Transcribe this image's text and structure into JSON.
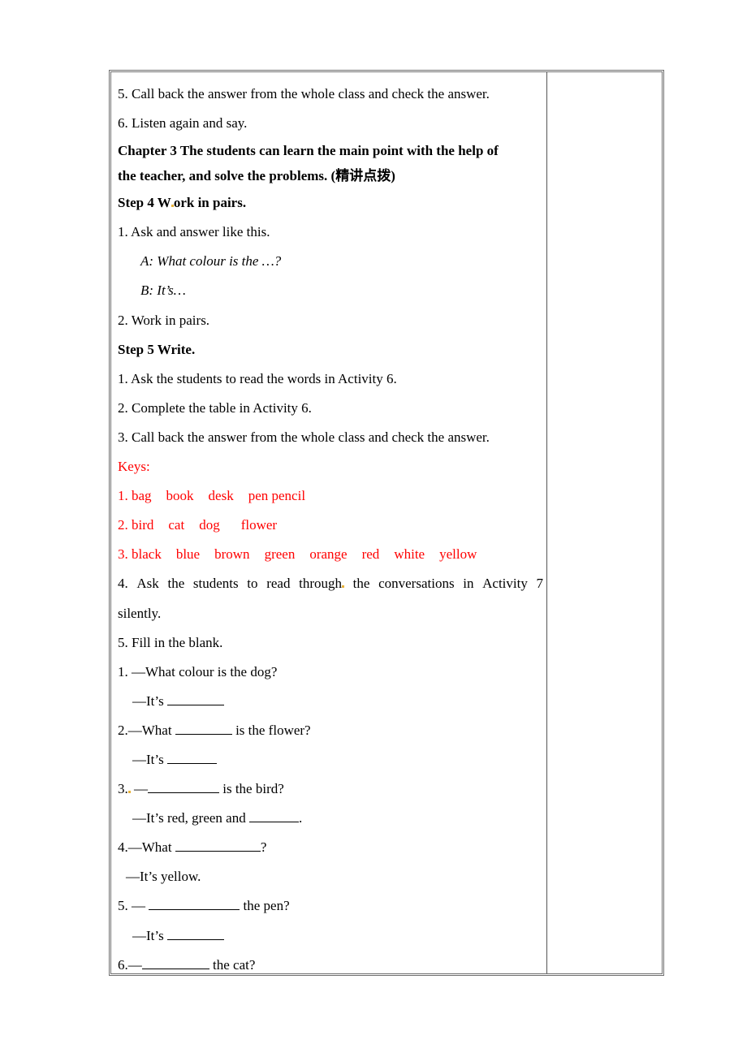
{
  "document": {
    "lines": {
      "l1": "5. Call back the answer from the whole class and check the answer.",
      "l2": "6. Listen again and say.",
      "chapter_a": "Chapter 3 The students can learn the main point with the help of",
      "chapter_b": "the teacher, and solve the problems. (精讲点拨)",
      "step4_a": "Step 4 W",
      "step4_b": "ork in pairs.",
      "s4_1": "1. Ask and answer like this.",
      "s4_a": "A: What colour is the …?",
      "s4_b": "B: It’s…",
      "s4_2": "2. Work in pairs.",
      "step5": "Step 5 Write.",
      "s5_1": "1. Ask the students to read the words in Activity 6.",
      "s5_2": "2. Complete the table in Activity 6.",
      "s5_3": "3. Call back the answer from the whole class and check the answer.",
      "keys": "Keys:",
      "s5_4_words": [
        "4.",
        "Ask",
        "the",
        "students",
        "to",
        "read",
        "through",
        "the",
        "conversations",
        "in",
        "Activity",
        "7"
      ],
      "s5_4_tail": "silently.",
      "s5_5": "5. Fill in the blank."
    },
    "keys": {
      "row1": [
        "1. bag",
        "book",
        "desk",
        "pen pencil"
      ],
      "row2": [
        "2. bird",
        "cat",
        "dog",
        "flower"
      ],
      "row3": [
        "3. black",
        "blue",
        "brown",
        "green",
        "orange",
        "red",
        "white",
        "yellow"
      ]
    },
    "exercise": {
      "q1": "1. —What colour is the dog?",
      "a1": "—It’s",
      "q2_pre": "2.—What",
      "q2_post": "is the flower?",
      "a2": "—It’s",
      "q3_pre": "3.",
      "q3_dash": "—",
      "q3_post": "is the bird?",
      "a3_pre": "—It’s red, green and",
      "a3_post": ".",
      "q4_pre": "4.—What",
      "q4_post": "?",
      "a4": "—It’s yellow.",
      "q5_pre": "5. —",
      "q5_post": "the pen?",
      "a5": "—It’s",
      "q6_pre": "6.—",
      "q6_post": "the cat?"
    },
    "colors": {
      "keys_text": "#ff0000",
      "border": "#6e6e6e",
      "marker": "#e8b23a"
    }
  }
}
